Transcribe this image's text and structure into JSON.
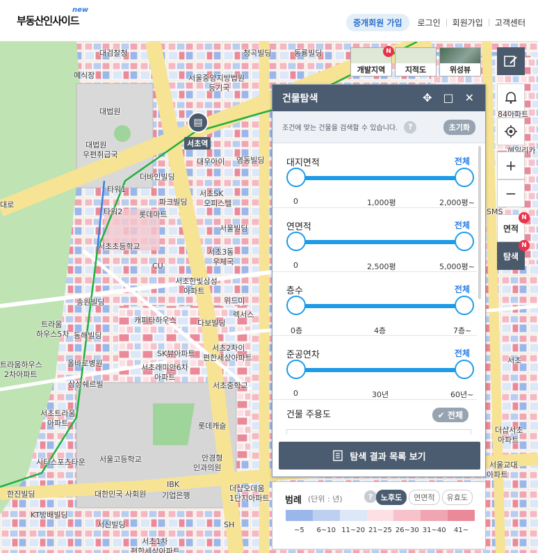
{
  "header": {
    "logo": "부동산인사이드",
    "logo_badge": "new",
    "agent_signup": "중개회원 가입",
    "login": "로그인",
    "signup": "회원가입",
    "support": "고객센터"
  },
  "map_types": [
    {
      "label": "개발지역",
      "badge": "N"
    },
    {
      "label": "지적도"
    },
    {
      "label": "위성뷰"
    }
  ],
  "tools": {
    "area_label": "면적",
    "search_label": "탐색",
    "badge": "N"
  },
  "map_labels": {
    "l1": "대검찰청",
    "l2": "예식장",
    "l3": "대법원",
    "l4": "대법원",
    "l5": "우편취급국",
    "l6": "서울중앙지방법원",
    "l7": "등기국",
    "l8": "청곡빌딩",
    "l9": "동룡빌딩",
    "l10": "서초역",
    "l11": "서초SK",
    "l12": "오피스텔",
    "l13": "더바인빌딩",
    "l14": "타워1",
    "l15": "타워2",
    "l16": "롯데마트",
    "l17": "파크빌딩",
    "l18": "서울빌딩",
    "l19": "서초초등학교",
    "l20": "서초3동",
    "l21": "우체국",
    "l22": "서초한빛삼성",
    "l23": "아파트",
    "l24": "송원빌딩",
    "l25": "트라움",
    "l26": "하우스5차",
    "l27": "동해빌딩",
    "l28": "캐피타하우스",
    "l29": "다보빌딩",
    "l30": "렉서스",
    "l31": "트라움하우스",
    "l32": "2차아파트",
    "l33": "올바로병원",
    "l34": "SK뷰아파트",
    "l35": "서초래미안6차",
    "l36": "아파트",
    "l37": "서초2차이",
    "l38": "편한세상아파트",
    "l39": "삼성쉐르빌",
    "l40": "서초중학교",
    "l41": "서초트라움",
    "l42": "아파트",
    "l43": "서울고등학교",
    "l44": "시티스포츠타운",
    "l45": "안경형",
    "l46": "인과의원",
    "l47": "한진빌딩",
    "l48": "대한민국 사회원",
    "l49": "KT방배빌딩",
    "l50": "서신빌딩",
    "l51": "서초1차",
    "l52": "편한세상아파트",
    "l53": "더샵오데움",
    "l54": "1단지아파트",
    "l55": "롯데캐슬",
    "l56": "더샵서초",
    "l57": "아파트",
    "l58": "서초",
    "l59": "84아파트",
    "l60": "헤일리카",
    "l61": "SMS",
    "l62": "대로",
    "l63": "CU",
    "l64": "IBK",
    "l65": "기업은행",
    "l66": "영동빌딩",
    "l67": "대우아이",
    "l68": "위드미",
    "l69": "서울교대",
    "l70": "SH",
    "l71": "아파트"
  },
  "panel": {
    "title": "건물탐색",
    "description": "조건에 맞는 건물을 검색할 수 있습니다.",
    "reset": "초기화",
    "sections": [
      {
        "title": "대지면적",
        "all": "전체",
        "ticks": [
          "0",
          "1,000평",
          "2,000평~"
        ],
        "range": [
          0,
          2000
        ]
      },
      {
        "title": "연면적",
        "all": "전체",
        "ticks": [
          "0",
          "2,500평",
          "5,000평~"
        ],
        "range": [
          0,
          5000
        ]
      },
      {
        "title": "층수",
        "all": "전체",
        "ticks": [
          "0층",
          "4층",
          "7층~"
        ],
        "range": [
          0,
          7
        ]
      },
      {
        "title": "준공연차",
        "all": "전체",
        "ticks": [
          "0",
          "30년",
          "60년~"
        ],
        "range": [
          0,
          60
        ]
      }
    ],
    "usage_title": "건물 주용도",
    "usage_all": "✔ 전체",
    "result_button": "탐색 결과 목록 보기"
  },
  "legend": {
    "title": "범례",
    "unit": "(단위 : 년)",
    "tabs": [
      "노후도",
      "연면적",
      "유효도"
    ],
    "active_tab": "노후도",
    "labels": [
      "~5",
      "6~10",
      "11~20",
      "21~25",
      "26~30",
      "31~40",
      "41~"
    ],
    "colors": [
      "#9bb7ea",
      "#bdd0f2",
      "#dce7f8",
      "#fde0e4",
      "#f6c2cb",
      "#f0a6b2",
      "#ea8a99"
    ]
  },
  "colors": {
    "header_accent": "#2a6fc9",
    "panel_header": "#4b5c70",
    "slider": "#1e9be6",
    "badge": "#e8334a"
  }
}
